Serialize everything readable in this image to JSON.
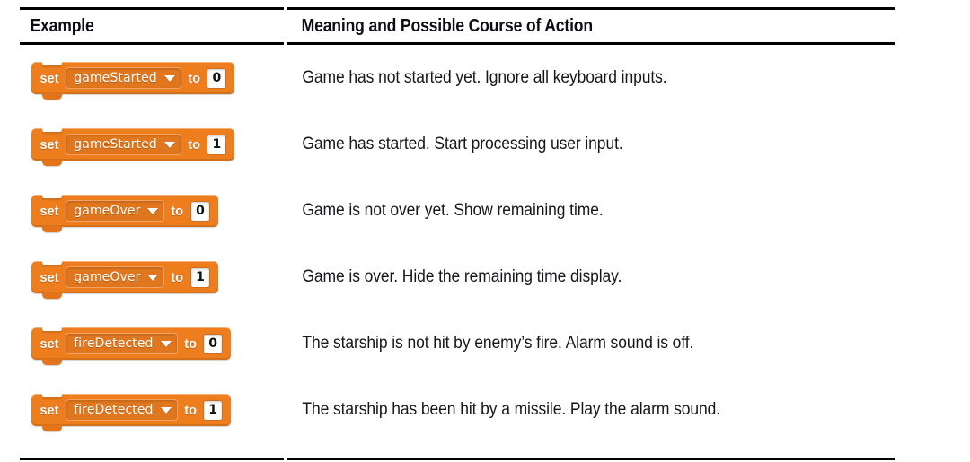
{
  "table": {
    "columns": [
      {
        "key": "example",
        "header": "Example"
      },
      {
        "key": "meaning",
        "header": "Meaning and Possible Course of Action"
      }
    ],
    "rows": [
      {
        "block": {
          "set_label": "set",
          "variable": "gameStarted",
          "to_label": "to",
          "value": "0",
          "dropdown_icon": "chevron-down-icon"
        },
        "meaning": "Game has not started yet. Ignore all keyboard inputs."
      },
      {
        "block": {
          "set_label": "set",
          "variable": "gameStarted",
          "to_label": "to",
          "value": "1",
          "dropdown_icon": "chevron-down-icon"
        },
        "meaning": "Game has started. Start processing user input."
      },
      {
        "block": {
          "set_label": "set",
          "variable": "gameOver",
          "to_label": "to",
          "value": "0",
          "dropdown_icon": "chevron-down-icon"
        },
        "meaning": "Game is not over yet. Show remaining time."
      },
      {
        "block": {
          "set_label": "set",
          "variable": "gameOver",
          "to_label": "to",
          "value": "1",
          "dropdown_icon": "chevron-down-icon"
        },
        "meaning": "Game is over. Hide the remaining time display."
      },
      {
        "block": {
          "set_label": "set",
          "variable": "fireDetected",
          "to_label": "to",
          "value": "0",
          "dropdown_icon": "chevron-down-icon"
        },
        "meaning": "The starship is not hit by enemy’s fire. Alarm sound is off."
      },
      {
        "block": {
          "set_label": "set",
          "variable": "fireDetected",
          "to_label": "to",
          "value": "1",
          "dropdown_icon": "chevron-down-icon"
        },
        "meaning": "The starship has been hit by a missile. Play the alarm sound."
      }
    ]
  },
  "colors": {
    "block_orange": "#ee7d1e",
    "block_orange_dark": "#e0761d",
    "block_border_light": "#f4a364",
    "value_box": "#ffffff",
    "rule": "#000000",
    "text": "#16161d"
  }
}
